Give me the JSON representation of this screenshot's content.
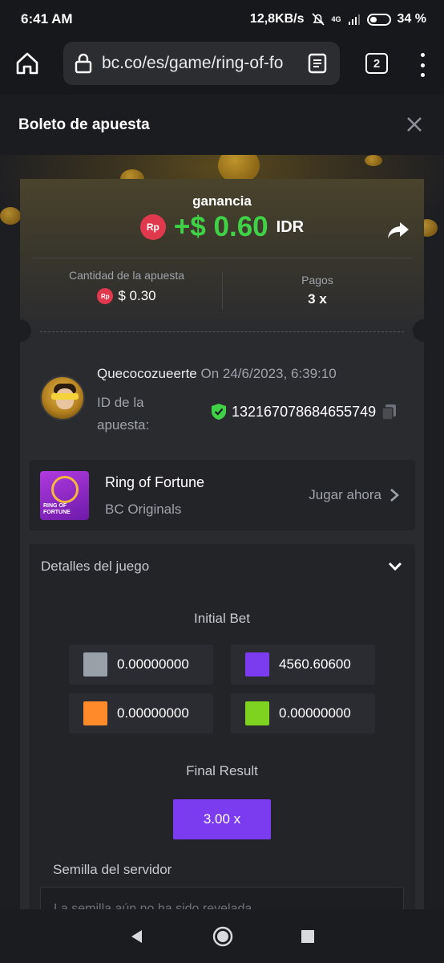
{
  "status_bar": {
    "time": "6:41 AM",
    "network_speed": "12,8KB/s",
    "network_type": "4G",
    "battery": "34 %"
  },
  "browser": {
    "url": "bc.co/es/game/ring-of-fo",
    "tab_count": "2"
  },
  "modal": {
    "title": "Boleto de apuesta"
  },
  "ticket": {
    "gain_label": "ganancia",
    "currency_badge": "Rp",
    "gain_amount": "+$ 0.60",
    "gain_currency": "IDR",
    "bet_amount_label": "Cantidad de la apuesta",
    "bet_amount_value": "$ 0.30",
    "payout_label": "Pagos",
    "payout_value": "3 x",
    "username": "Quecocozueerte",
    "date": "On 24/6/2023, 6:39:10",
    "bet_id_label": "ID de la apuesta:",
    "bet_id": "132167078684655749"
  },
  "game": {
    "name": "Ring of Fortune",
    "provider": "BC Originals",
    "thumb_text": "RING OF FORTUNE",
    "play_label": "Jugar ahora"
  },
  "details": {
    "header": "Detalles del juego",
    "initial_bet_title": "Initial Bet",
    "bets": [
      {
        "color": "#9aa0a8",
        "value": "0.00000000"
      },
      {
        "color": "#7b3cf0",
        "value": "4560.60600"
      },
      {
        "color": "#ff8a2a",
        "value": "0.00000000"
      },
      {
        "color": "#7ed321",
        "value": "0.00000000"
      }
    ],
    "final_result_title": "Final Result",
    "final_result": "3.00 x",
    "seed_label": "Semilla del servidor",
    "seed_placeholder": "La semilla aún no ha sido revelada"
  },
  "colors": {
    "accent_green": "#3fd247",
    "accent_purple": "#7b3cf0",
    "badge_red": "#e0384d"
  }
}
